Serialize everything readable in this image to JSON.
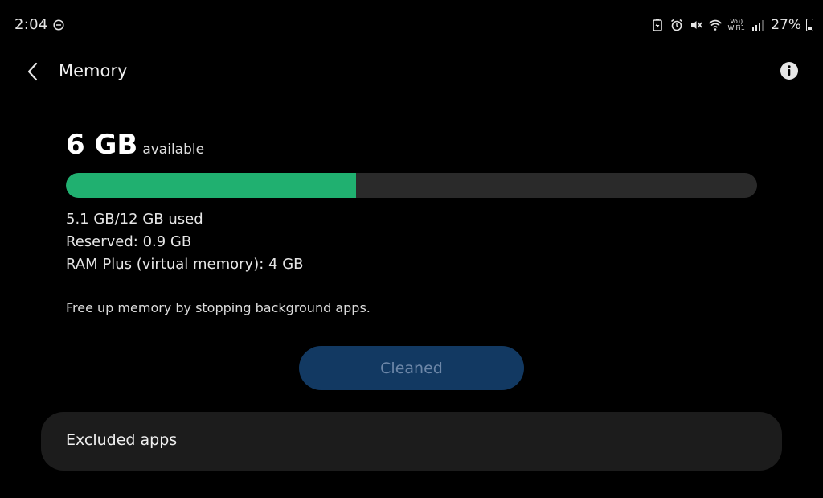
{
  "status_bar": {
    "time": "2:04",
    "volte_top": "Vo))",
    "volte_bottom": "WiFi1",
    "battery": "27%"
  },
  "header": {
    "title": "Memory"
  },
  "memory": {
    "available_value": "6 GB",
    "available_label": "available",
    "used_fraction": 0.42,
    "used_text": "5.1 GB/12 GB used",
    "reserved_text": "Reserved: 0.9 GB",
    "ram_plus_text": "RAM Plus (virtual memory): 4 GB",
    "hint": "Free up memory by stopping background apps.",
    "clean_button_label": "Cleaned"
  },
  "excluded": {
    "label": "Excluded apps"
  },
  "colors": {
    "bar_used": "#20b070",
    "bar_track": "#2a2a2a",
    "button_bg": "#123962",
    "button_text": "#6d87a8",
    "card_bg": "#1c1c1c"
  }
}
